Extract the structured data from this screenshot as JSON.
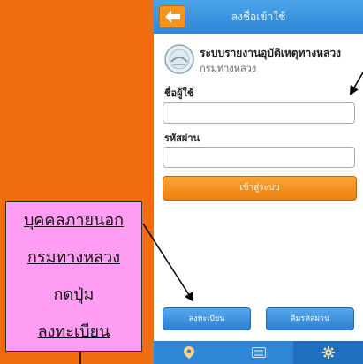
{
  "header": {
    "title": "ลงชื่อเข้าใช้"
  },
  "org": {
    "title": "ระบบรายงานอุบัติเหตุทางหลวง",
    "subtitle": "กรมทางหลวง"
  },
  "form": {
    "username_label": "ชื่อผู้ใช้",
    "username_value": "",
    "password_label": "รหัสผ่าน",
    "password_value": "",
    "login_label": "เข้าสู่ระบบ"
  },
  "actions": {
    "register_label": "ลงทะเบียน",
    "forgot_label": "ลืมรหัสผ่าน"
  },
  "tabbar": {
    "tabs": [
      {
        "icon": "location-pin-icon",
        "active": false
      },
      {
        "icon": "list-icon",
        "active": false
      },
      {
        "icon": "gear-icon",
        "active": true
      }
    ]
  },
  "annotation": {
    "lines": [
      "บุคคลภายนอก",
      "กรมทางหลวง",
      "กดปุ่ม",
      "ลงทะเบียน"
    ]
  },
  "colors": {
    "background": "#f26d10",
    "header": "#2f86d6",
    "login_button": "#ee7e12",
    "action_button": "#2d7fd3",
    "callout": "#ff9ef2"
  }
}
